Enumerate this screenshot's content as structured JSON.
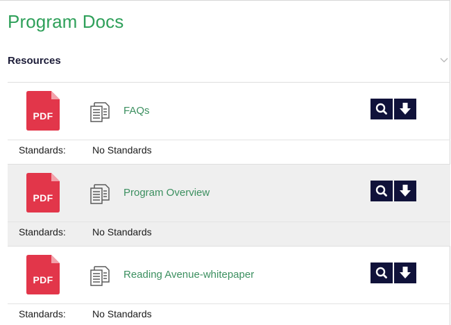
{
  "page": {
    "title": "Program Docs",
    "section_title": "Resources",
    "colors": {
      "title_green": "#2fa05a",
      "link_green": "#3b8f5f",
      "pdf_red": "#e2364a",
      "button_navy": "#10123a",
      "alt_row": "#efefef"
    }
  },
  "resources": [
    {
      "file_type": "PDF",
      "doc_icon": "document-stack-icon",
      "name": "FAQs",
      "standards_label": "Standards:",
      "standards_value": "No Standards"
    },
    {
      "file_type": "PDF",
      "doc_icon": "document-stack-icon",
      "name": "Program Overview",
      "standards_label": "Standards:",
      "standards_value": "No Standards"
    },
    {
      "file_type": "PDF",
      "doc_icon": "document-stack-icon",
      "name": "Reading Avenue-whitepaper",
      "standards_label": "Standards:",
      "standards_value": "No Standards"
    }
  ],
  "actions": {
    "view_icon": "search-icon",
    "download_icon": "download-arrow-icon"
  }
}
